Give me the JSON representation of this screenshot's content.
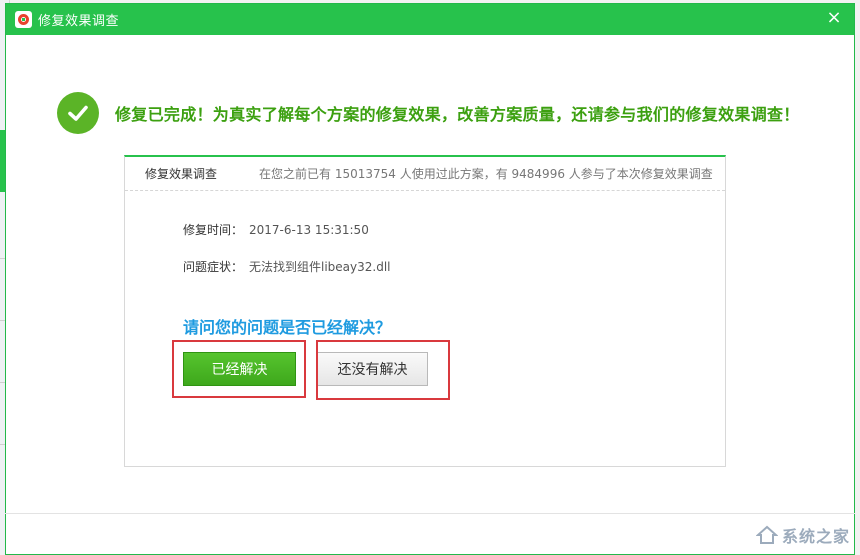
{
  "window": {
    "title": "修复效果调查",
    "close_symbol": "×"
  },
  "headline": "修复已完成！为真实了解每个方案的修复效果，改善方案质量，还请参与我们的修复效果调查！",
  "survey": {
    "title": "修复效果调查",
    "stats": "在您之前已有 15013754 人使用过此方案，有 9484996 人参与了本次修复效果调查",
    "repair_time_label": "修复时间：",
    "repair_time_value": "2017-6-13 15:31:50",
    "symptom_label": "问题症状：",
    "symptom_value": "无法找到组件libeay32.dll",
    "question": "请问您的问题是否已经解决？",
    "btn_resolved": "已经解决",
    "btn_unresolved": "还没有解决"
  },
  "watermark": "系统之家",
  "colors": {
    "titlebar": "#27c24c",
    "accent_green": "#3ca010",
    "question_blue": "#1f9be0",
    "highlight_red": "#d9393e"
  }
}
